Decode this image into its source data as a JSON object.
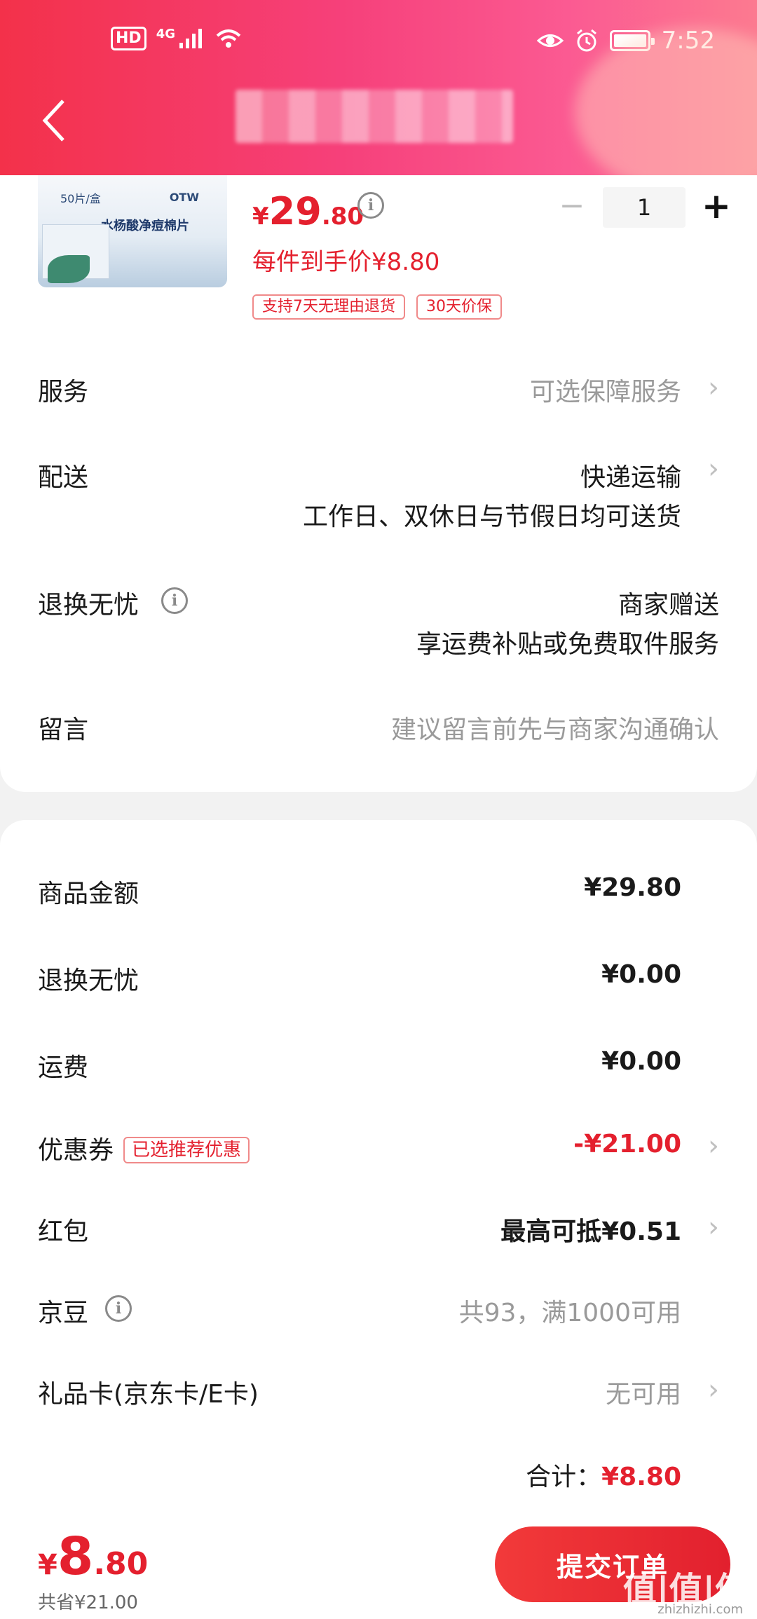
{
  "status_bar": {
    "hd": "HD",
    "network": "4G",
    "time": "7:52"
  },
  "header": {
    "back_icon": "chevron-left-icon"
  },
  "product": {
    "image": {
      "count": "50片/盒",
      "brand": "OTW",
      "name": "水杨酸净痘棉片"
    },
    "price": {
      "currency": "¥",
      "integer": "29",
      "decimal": ".80"
    },
    "unit_price": "每件到手价¥8.80",
    "tags": [
      "支持7天无理由退货",
      "30天价保"
    ],
    "quantity": {
      "minus": "−",
      "value": "1",
      "plus": "+"
    }
  },
  "options": {
    "service": {
      "label": "服务",
      "value": "可选保障服务"
    },
    "delivery": {
      "label": "配送",
      "value": "快递运输",
      "sub": "工作日、双休日与节假日均可送货"
    },
    "return": {
      "label": "退换无忧",
      "value": "商家赠送",
      "sub": "享运费补贴或免费取件服务"
    },
    "message": {
      "label": "留言",
      "placeholder": "建议留言前先与商家沟通确认"
    }
  },
  "summary": {
    "goods_amount": {
      "label": "商品金额",
      "value": "¥29.80"
    },
    "return_fee": {
      "label": "退换无忧",
      "value": "¥0.00"
    },
    "shipping": {
      "label": "运费",
      "value": "¥0.00"
    },
    "coupon": {
      "label": "优惠券",
      "tag": "已选推荐优惠",
      "value": "-¥21.00"
    },
    "red_packet": {
      "label": "红包",
      "value": "最高可抵¥0.51"
    },
    "jd_beans": {
      "label": "京豆",
      "value": "共93，满1000可用"
    },
    "gift_card": {
      "label": "礼品卡(京东卡/E卡)",
      "value": "无可用"
    },
    "total": {
      "label": "合计：",
      "value": "¥8.80"
    }
  },
  "bottom": {
    "price": {
      "currency": "¥",
      "integer": "8",
      "decimal": ".80"
    },
    "saved": "共省¥21.00",
    "submit": "提交订单",
    "watermark": "值|值|值",
    "watermark_url": "zhizhizhi.com"
  },
  "colors": {
    "accent": "#e4202e",
    "header_start": "#f3314a",
    "header_end": "#fc7a90"
  }
}
